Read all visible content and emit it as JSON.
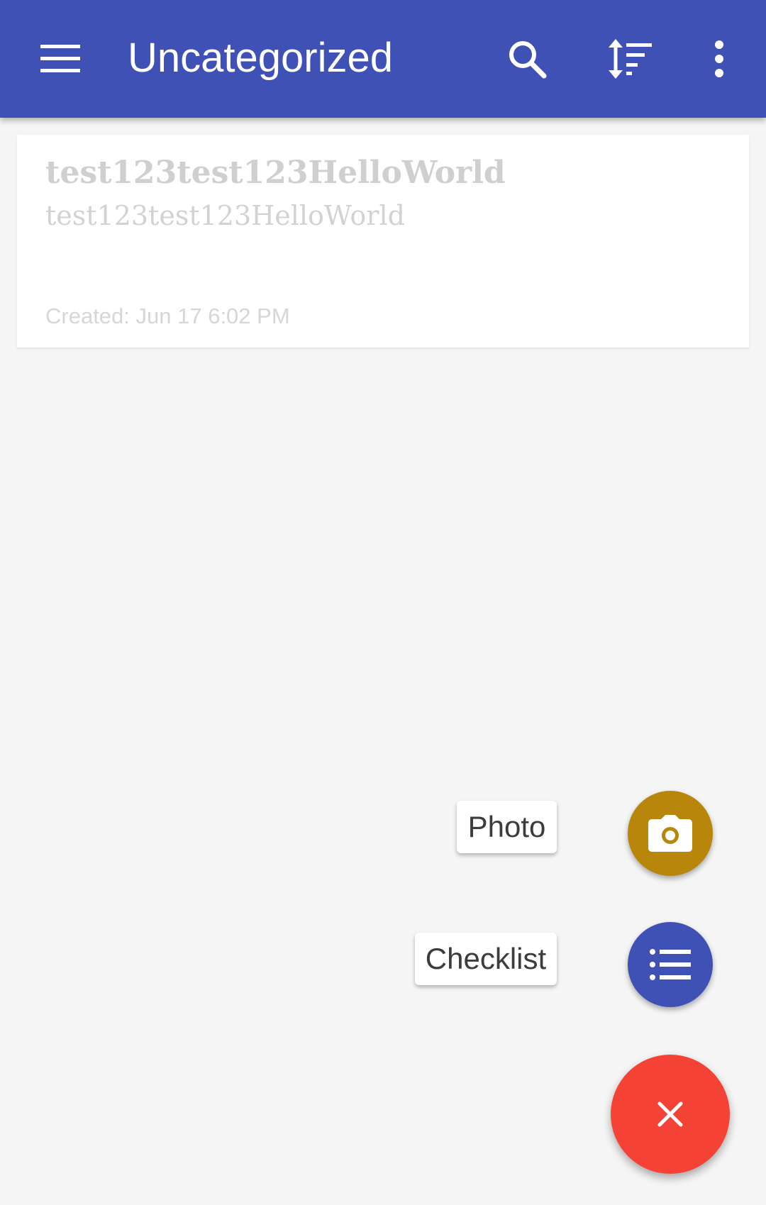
{
  "appbar": {
    "title": "Uncategorized",
    "color": "#3f51b5",
    "icons": [
      "menu-icon",
      "search-icon",
      "sort-icon",
      "more-vert-icon"
    ]
  },
  "notes": [
    {
      "title": "test123test123HelloWorld",
      "body": "test123test123HelloWorld",
      "created": "Created: Jun 17 6:02 PM"
    }
  ],
  "fab_menu": {
    "photo": {
      "label": "Photo",
      "icon": "camera-icon",
      "color": "#b8860b"
    },
    "checklist": {
      "label": "Checklist",
      "icon": "list-icon",
      "color": "#3f51b5"
    },
    "close": {
      "icon": "close-icon",
      "color": "#f44336"
    }
  }
}
